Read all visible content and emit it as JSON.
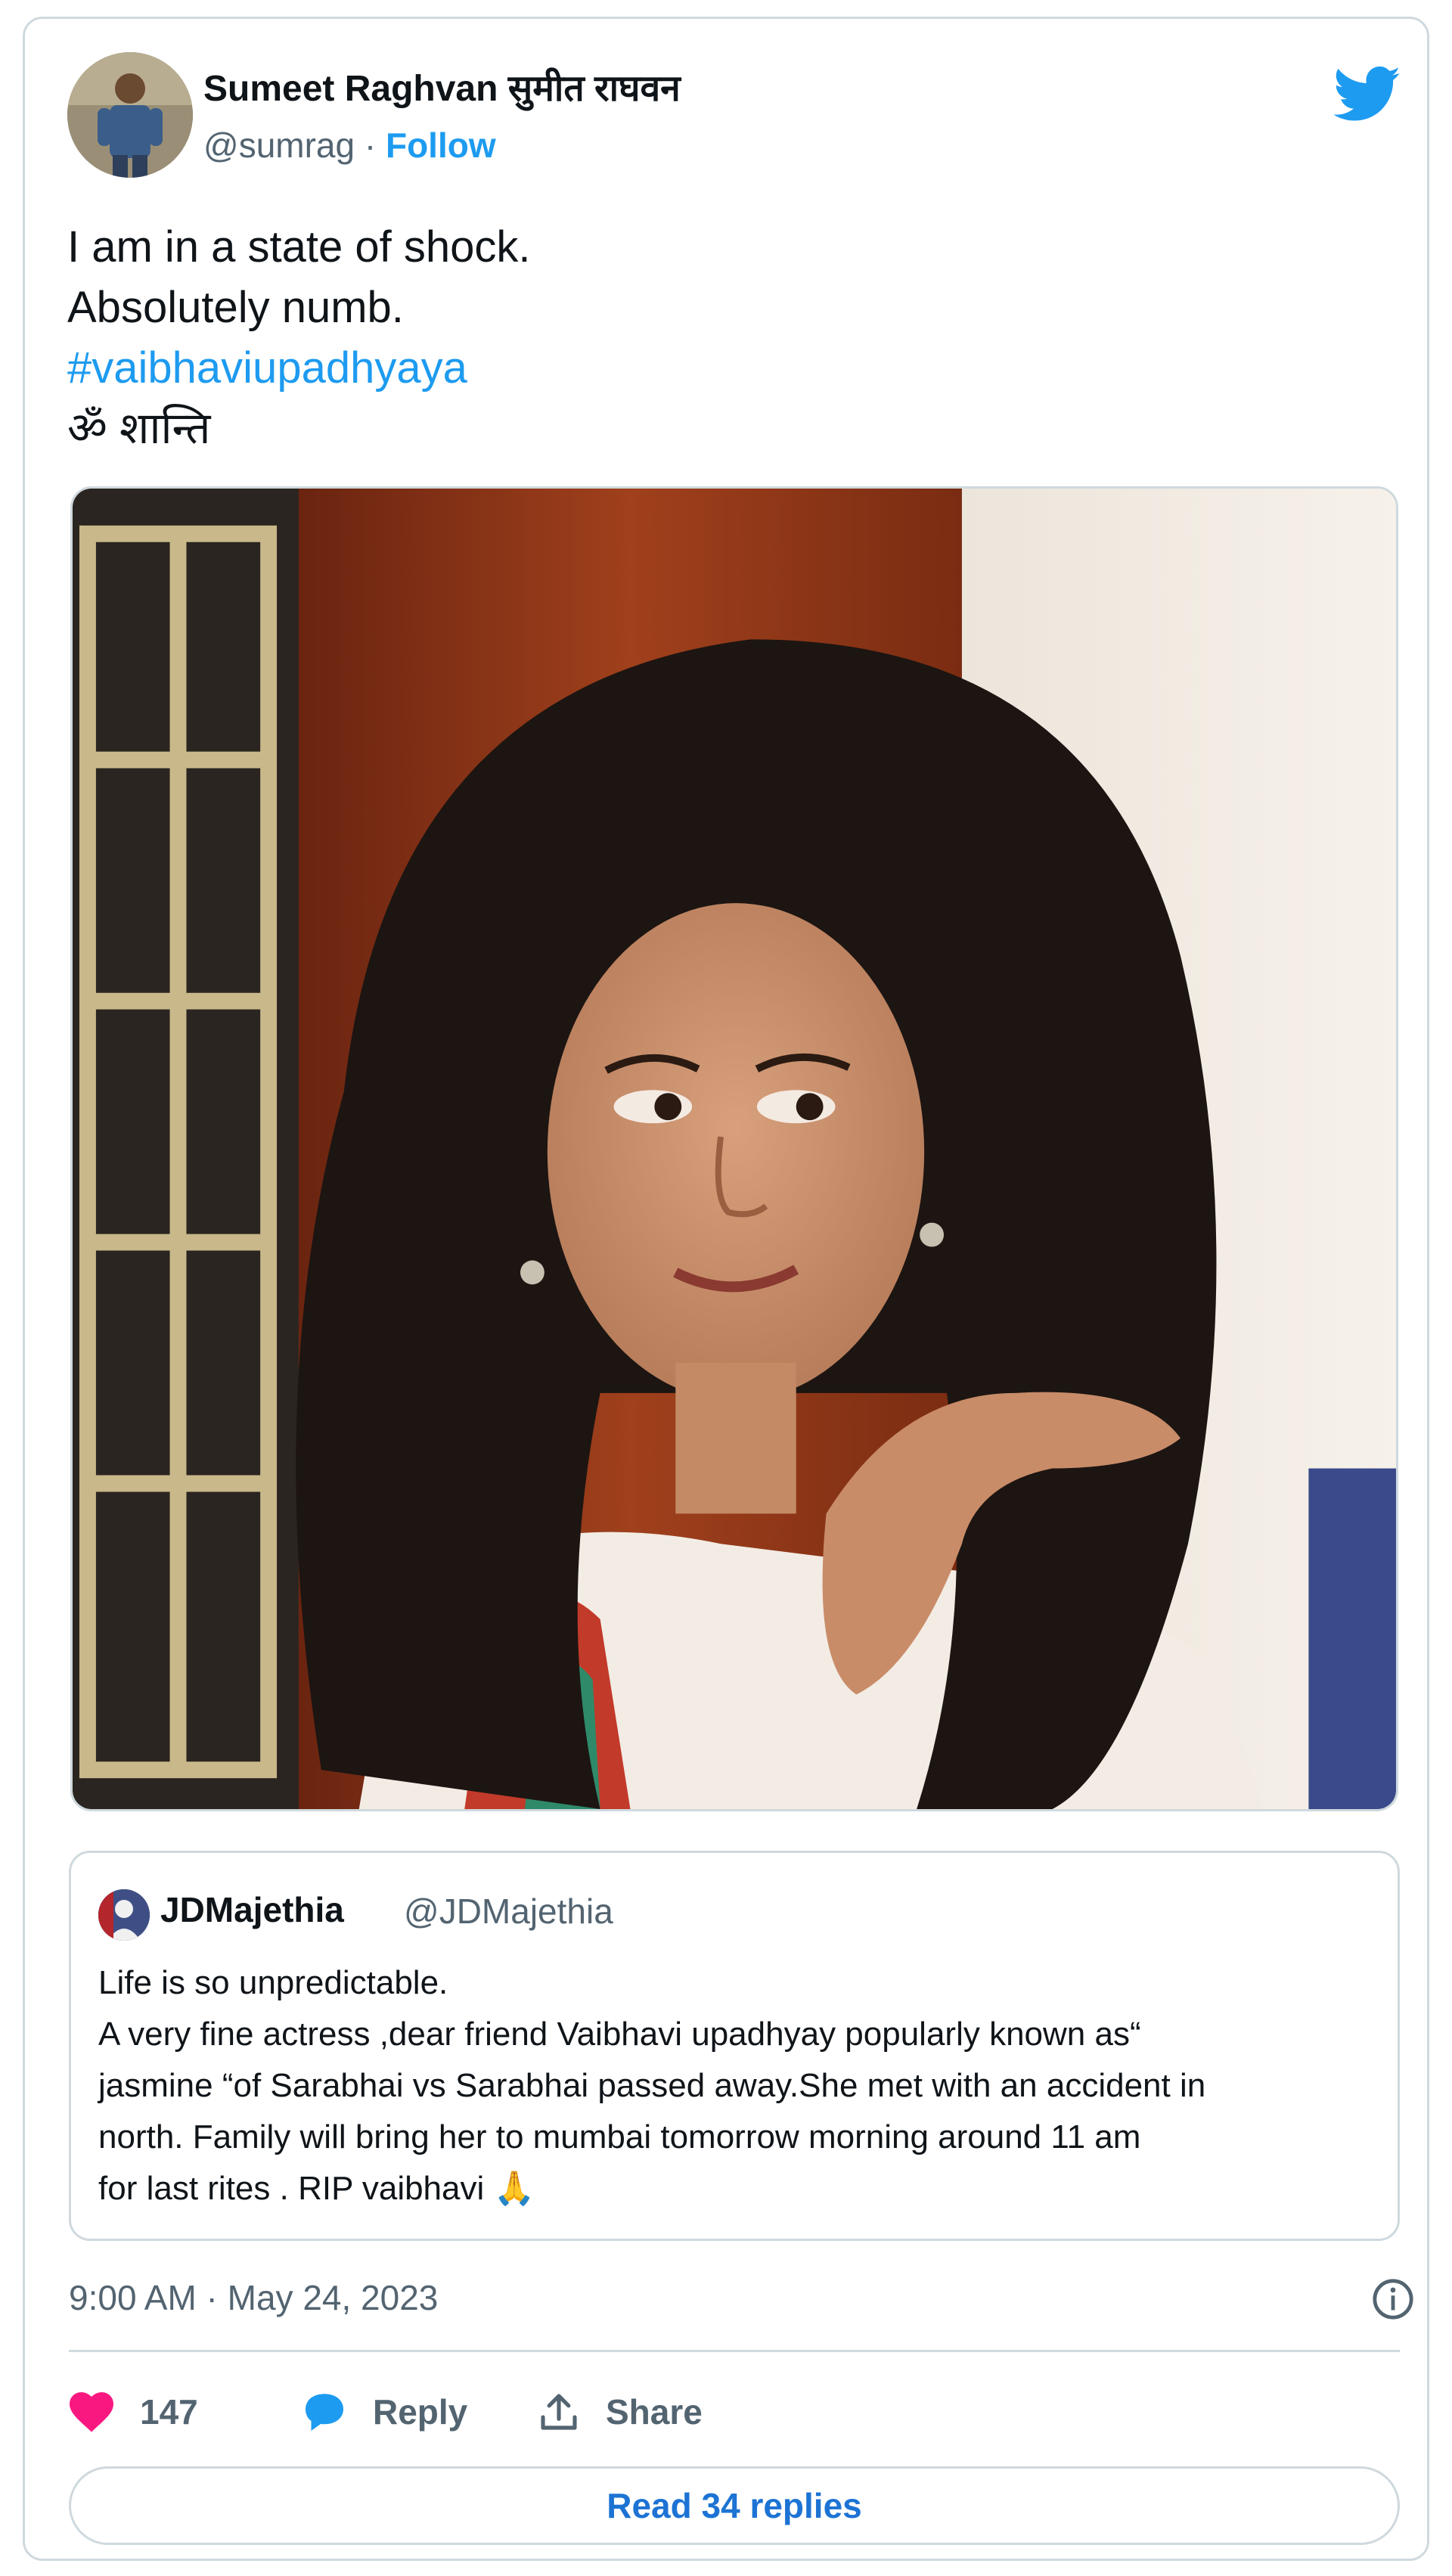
{
  "author": {
    "name": "Sumeet Raghvan सुमीत राघवन",
    "handle": "@sumrag",
    "separator": " · ",
    "follow_label": "Follow"
  },
  "tweet": {
    "lines": [
      "I am in a state of shock.",
      "Absolutely numb.",
      "#vaibhaviupadhyaya",
      "ॐ शान्ति"
    ]
  },
  "media": {
    "description_icon": "photo-image"
  },
  "quoted_tweet": {
    "name": "JDMajethia",
    "handle": "@JDMajethia",
    "lines": [
      "Life is so unpredictable.",
      "A very fine actress ,dear friend Vaibhavi upadhyay popularly known as“",
      "jasmine “of Sarabhai vs Sarabhai passed away.She met with an accident in",
      "north. Family will bring her to mumbai tomorrow morning around 11 am",
      "for last rites . RIP vaibhavi 🙏"
    ]
  },
  "meta": {
    "timestamp": "9:00 AM · May 24, 2023"
  },
  "actions": {
    "like_count": "147",
    "reply_label": "Reply",
    "share_label": "Share"
  },
  "footer": {
    "read_replies_label": "Read 34 replies"
  },
  "colors": {
    "accent": "#1d9bf0",
    "like": "#f91880",
    "text": "#0f1419",
    "muted": "#536471",
    "border": "#cfd9de"
  },
  "icons": [
    "twitter-bird-icon",
    "info-icon",
    "heart-icon",
    "reply-bubble-icon",
    "share-upload-icon"
  ]
}
